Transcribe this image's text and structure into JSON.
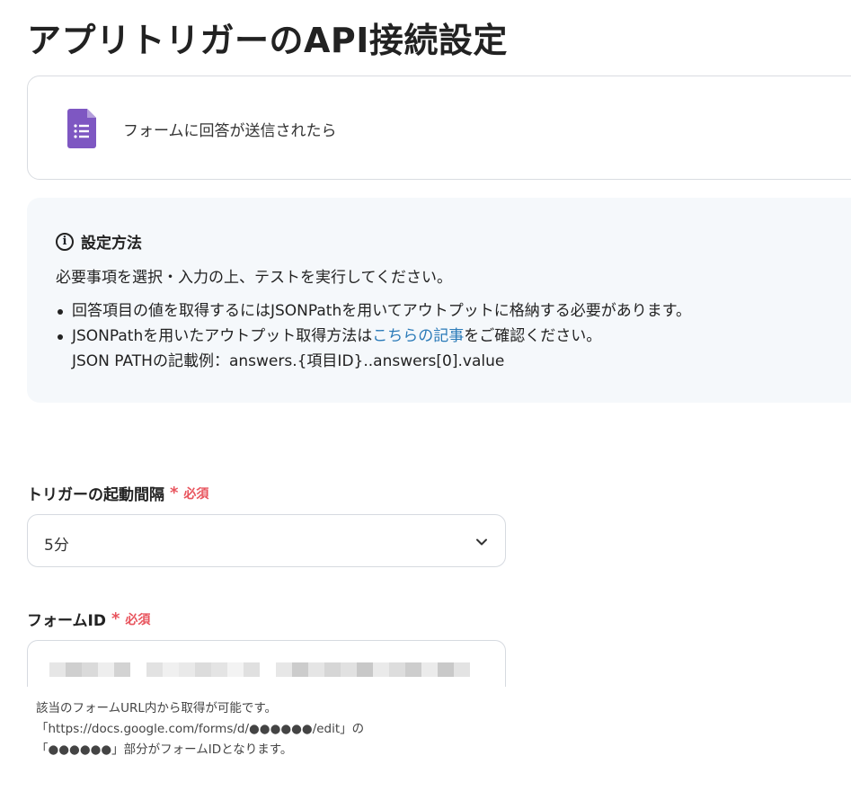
{
  "page": {
    "title": "アプリトリガーのAPI接続設定"
  },
  "app_card": {
    "icon": "google-forms-icon",
    "trigger_label": "フォームに回答が送信されたら",
    "icon_color": "#7e57c2"
  },
  "info": {
    "title": "設定方法",
    "intro": "必要事項を選択・入力の上、テストを実行してください。",
    "bullet1": "回答項目の値を取得するにはJSONPathを用いてアウトプットに格納する必要があります。",
    "bullet2_prefix": "JSONPathを用いたアウトプット取得方法は",
    "bullet2_link": "こちらの記事",
    "bullet2_suffix": "をご確認ください。",
    "bullet2_line2": "JSON PATHの記載例：answers.{項目ID}..answers[0].value"
  },
  "trigger_interval": {
    "label": "トリガーの起動間隔",
    "required_mark": "*",
    "required_text": "必須",
    "value": "5分"
  },
  "form_id": {
    "label": "フォームID",
    "required_mark": "*",
    "required_text": "必須",
    "help_line1": "該当のフォームURL内から取得が可能です。",
    "help_line2": "「https://docs.google.com/forms/d/●●●●●●/edit」の",
    "help_line3": "「●●●●●●」部分がフォームIDとなります。"
  },
  "colors": {
    "required": "#e8545d",
    "link": "#2a7ab8",
    "info_bg": "#f5f8fb"
  }
}
